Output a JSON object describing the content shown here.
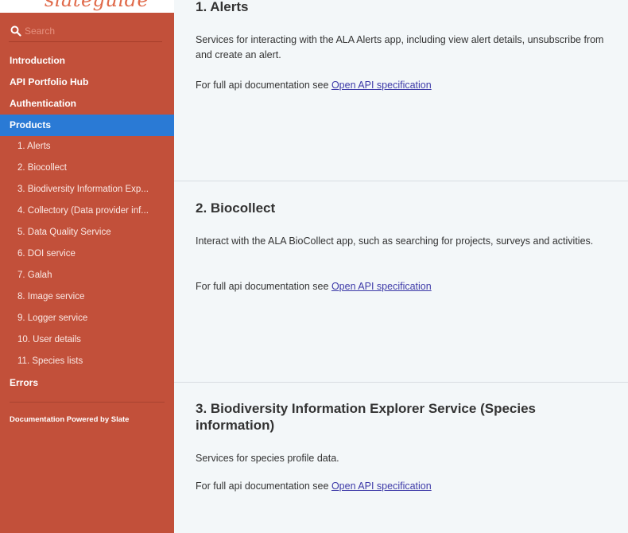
{
  "sidebar": {
    "logo_text": "slateguide",
    "search": {
      "placeholder": "Search"
    },
    "items": [
      {
        "label": "Introduction"
      },
      {
        "label": "API Portfolio Hub"
      },
      {
        "label": "Authentication"
      },
      {
        "label": "Products",
        "active": true
      },
      {
        "label": "1. Alerts"
      },
      {
        "label": "2. Biocollect"
      },
      {
        "label": "3. Biodiversity Information Exp..."
      },
      {
        "label": "4. Collectory (Data provider inf..."
      },
      {
        "label": "5. Data Quality Service"
      },
      {
        "label": "6. DOI service"
      },
      {
        "label": "7. Galah"
      },
      {
        "label": "8. Image service"
      },
      {
        "label": "9. Logger service"
      },
      {
        "label": "10. User details"
      },
      {
        "label": "11. Species lists"
      },
      {
        "label": "Errors"
      }
    ],
    "footer": "Documentation Powered by Slate"
  },
  "main": {
    "link_prefix": "For full api documentation see ",
    "link_label": "Open API specification",
    "sections": [
      {
        "title": "1. Alerts",
        "description": "Services for interacting with the ALA Alerts app, including view alert details, unsubscribe from and create an alert."
      },
      {
        "title": "2. Biocollect",
        "description": "Interact with the ALA BioCollect app, such as searching for projects, surveys and activities."
      },
      {
        "title": "3. Biodiversity Information Explorer Service (Species information)",
        "description": "Services for species profile data."
      }
    ]
  },
  "colors": {
    "sidebar_bg": "#c2503a",
    "active_bg": "#2a7ad5",
    "content_bg": "#f3f7f9",
    "link": "#3d3aa8"
  }
}
